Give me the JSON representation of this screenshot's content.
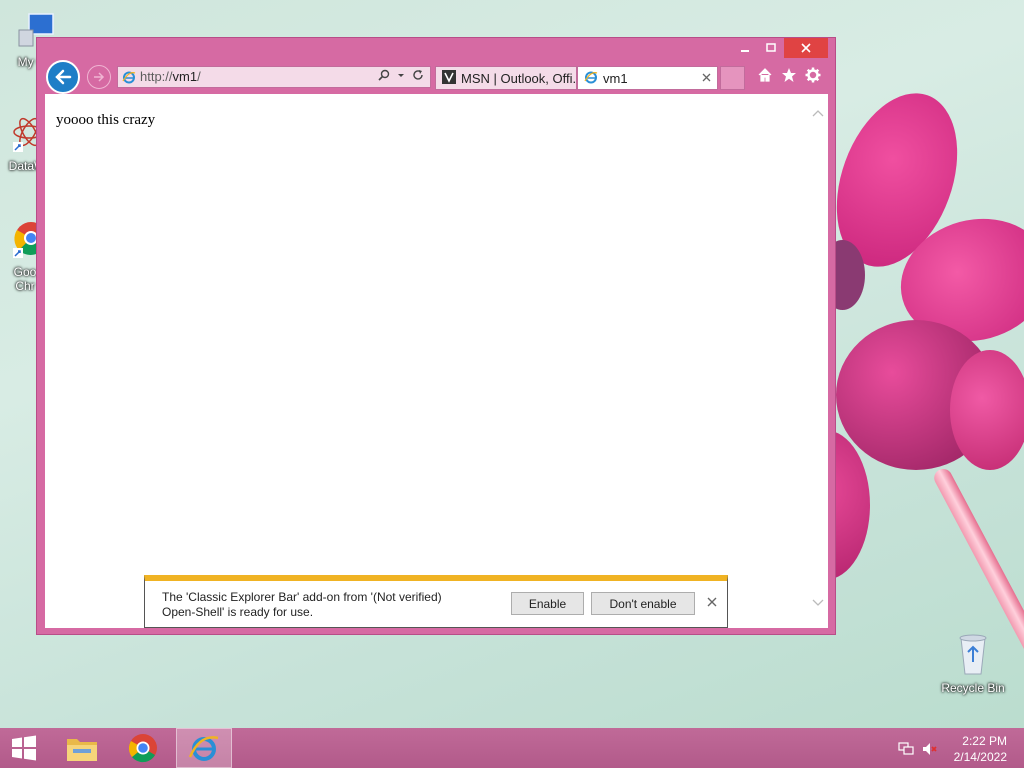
{
  "desktop": {
    "icons": [
      {
        "label": "My Co",
        "icon": "computer-icon"
      },
      {
        "label": "DataW",
        "icon": "datawindow-icon"
      },
      {
        "label": "Goo Chr",
        "icon": "chrome-icon"
      },
      {
        "label": "Recycle Bin",
        "icon": "recycle-bin-icon"
      }
    ]
  },
  "browser": {
    "address": {
      "prefix": "http://",
      "host": "vm1",
      "suffix": "/"
    },
    "tabs": [
      {
        "label": "MSN | Outlook, Offi...",
        "icon": "msn-icon"
      },
      {
        "label": "vm1",
        "icon": "ie-icon",
        "active": true
      }
    ],
    "page_text": "yoooo this crazy",
    "notification": {
      "message_line1": "The 'Classic Explorer Bar' add-on from '(Not verified)",
      "message_line2": "Open-Shell' is ready for use.",
      "enable_label": "Enable",
      "dont_enable_label": "Don't enable"
    }
  },
  "taskbar": {
    "items": [
      "start-button",
      "file-explorer",
      "chrome",
      "internet-explorer"
    ],
    "clock_time": "2:22 PM",
    "clock_date": "2/14/2022"
  },
  "colors": {
    "window_frame": "#d66aa3",
    "taskbar": "#b25a8a",
    "notification_accent": "#f0b323",
    "back_button": "#1e7ec7"
  }
}
